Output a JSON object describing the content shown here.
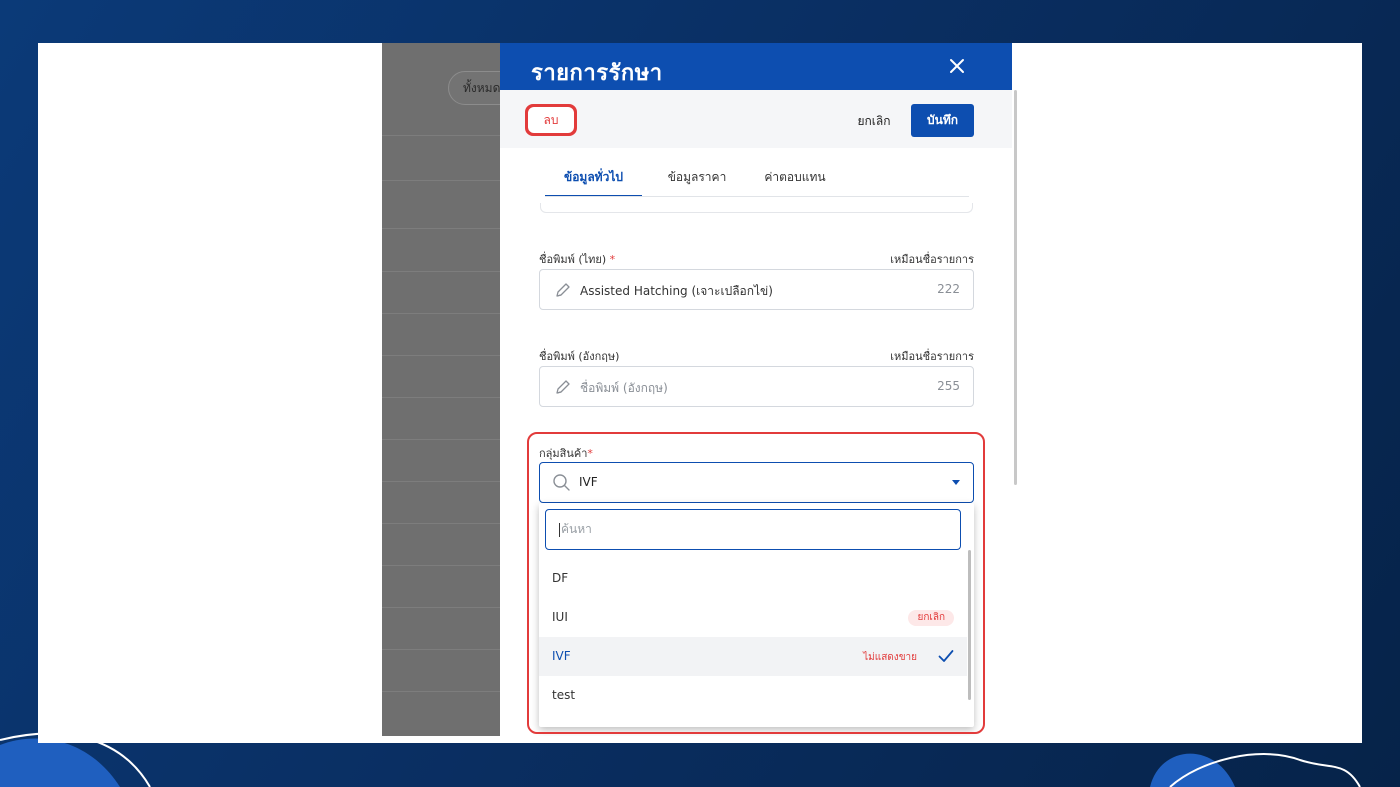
{
  "background_page": {
    "filter_chip_label": "ทั้งหมด"
  },
  "modal": {
    "title": "รายการรักษา",
    "close_icon": "close-icon",
    "actions": {
      "delete_label": "ลบ",
      "cancel_label": "ยกเลิก",
      "save_label": "บันทึก"
    },
    "tabs": [
      {
        "label": "ข้อมูลทั่วไป",
        "active": true
      },
      {
        "label": "ข้อมูลราคา",
        "active": false
      },
      {
        "label": "ค่าตอบแทน",
        "active": false
      }
    ],
    "fields": {
      "print_name_th": {
        "label": "ชื่อพิมพ์ (ไทย)",
        "required_mark": "*",
        "hint": "เหมือนชื่อรายการ",
        "value": "Assisted Hatching (เจาะเปลือกไข่)",
        "counter": "222",
        "icon": "pencil-icon"
      },
      "print_name_en": {
        "label": "ชื่อพิมพ์ (อังกฤษ)",
        "hint": "เหมือนชื่อรายการ",
        "placeholder": "ชื่อพิมพ์ (อังกฤษ)",
        "counter": "255",
        "icon": "pencil-icon"
      },
      "product_group": {
        "label": "กลุ่มสินค้า",
        "required_mark": "*",
        "value": "IVF",
        "icon": "search-icon",
        "dropdown": {
          "search_placeholder": "ค้นหา",
          "options": [
            {
              "label": "DF",
              "badge": "",
              "selected": false
            },
            {
              "label": "IUI",
              "badge": "ยกเลิก",
              "selected": false
            },
            {
              "label": "IVF",
              "badge": "ไม่แสดงขาย",
              "selected": true
            },
            {
              "label": "test",
              "badge": "",
              "selected": false
            }
          ]
        }
      }
    }
  },
  "colors": {
    "primary": "#0d4eb0",
    "danger": "#e23b3b",
    "background": "#0a2f63"
  }
}
